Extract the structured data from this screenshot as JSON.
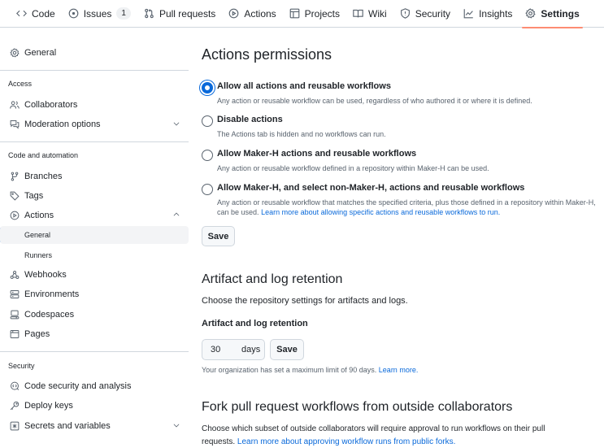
{
  "topnav": {
    "tabs": [
      {
        "label": "Code",
        "icon": "code-icon"
      },
      {
        "label": "Issues",
        "icon": "issue-icon",
        "count": "1"
      },
      {
        "label": "Pull requests",
        "icon": "pull-request-icon"
      },
      {
        "label": "Actions",
        "icon": "play-icon"
      },
      {
        "label": "Projects",
        "icon": "table-icon"
      },
      {
        "label": "Wiki",
        "icon": "book-icon"
      },
      {
        "label": "Security",
        "icon": "shield-icon"
      },
      {
        "label": "Insights",
        "icon": "graph-icon"
      },
      {
        "label": "Settings",
        "icon": "gear-icon",
        "selected": true
      }
    ],
    "accent_color": "#fd8c73"
  },
  "sidebar": {
    "general": "General",
    "access_heading": "Access",
    "collaborators": "Collaborators",
    "moderation": "Moderation options",
    "code_automation_heading": "Code and automation",
    "branches": "Branches",
    "tags": "Tags",
    "actions": "Actions",
    "actions_general": "General",
    "actions_runners": "Runners",
    "webhooks": "Webhooks",
    "environments": "Environments",
    "codespaces": "Codespaces",
    "pages": "Pages",
    "security_heading": "Security",
    "code_security": "Code security and analysis",
    "deploy_keys": "Deploy keys",
    "secrets": "Secrets and variables",
    "active_color": "#0969da"
  },
  "main": {
    "permissions": {
      "title": "Actions permissions",
      "options": [
        {
          "label": "Allow all actions and reusable workflows",
          "desc": "Any action or reusable workflow can be used, regardless of who authored it or where it is defined.",
          "checked": true
        },
        {
          "label": "Disable actions",
          "desc": "The Actions tab is hidden and no workflows can run.",
          "checked": false
        },
        {
          "label": "Allow Maker-H actions and reusable workflows",
          "desc": "Any action or reusable workflow defined in a repository within Maker-H can be used.",
          "checked": false
        },
        {
          "label": "Allow Maker-H, and select non-Maker-H, actions and reusable workflows",
          "desc": "Any action or reusable workflow that matches the specified criteria, plus those defined in a repository within Maker-H, can be used.",
          "link": "Learn more about allowing specific actions and reusable workflows to run.",
          "checked": false
        }
      ],
      "save_label": "Save"
    },
    "artifact": {
      "title": "Artifact and log retention",
      "subtitle": "Choose the repository settings for artifacts and logs.",
      "field_label": "Artifact and log retention",
      "value": "30",
      "unit": "days",
      "save_label": "Save",
      "note": "Your organization has set a maximum limit of 90 days.",
      "note_link": "Learn more."
    },
    "fork": {
      "title": "Fork pull request workflows from outside collaborators",
      "desc_line1": "Choose which subset of outside collaborators will require approval to run workflows on their pull",
      "desc_line2": "requests.",
      "link": "Learn more about approving workflow runs from public forks."
    },
    "link_color": "#0969da"
  }
}
